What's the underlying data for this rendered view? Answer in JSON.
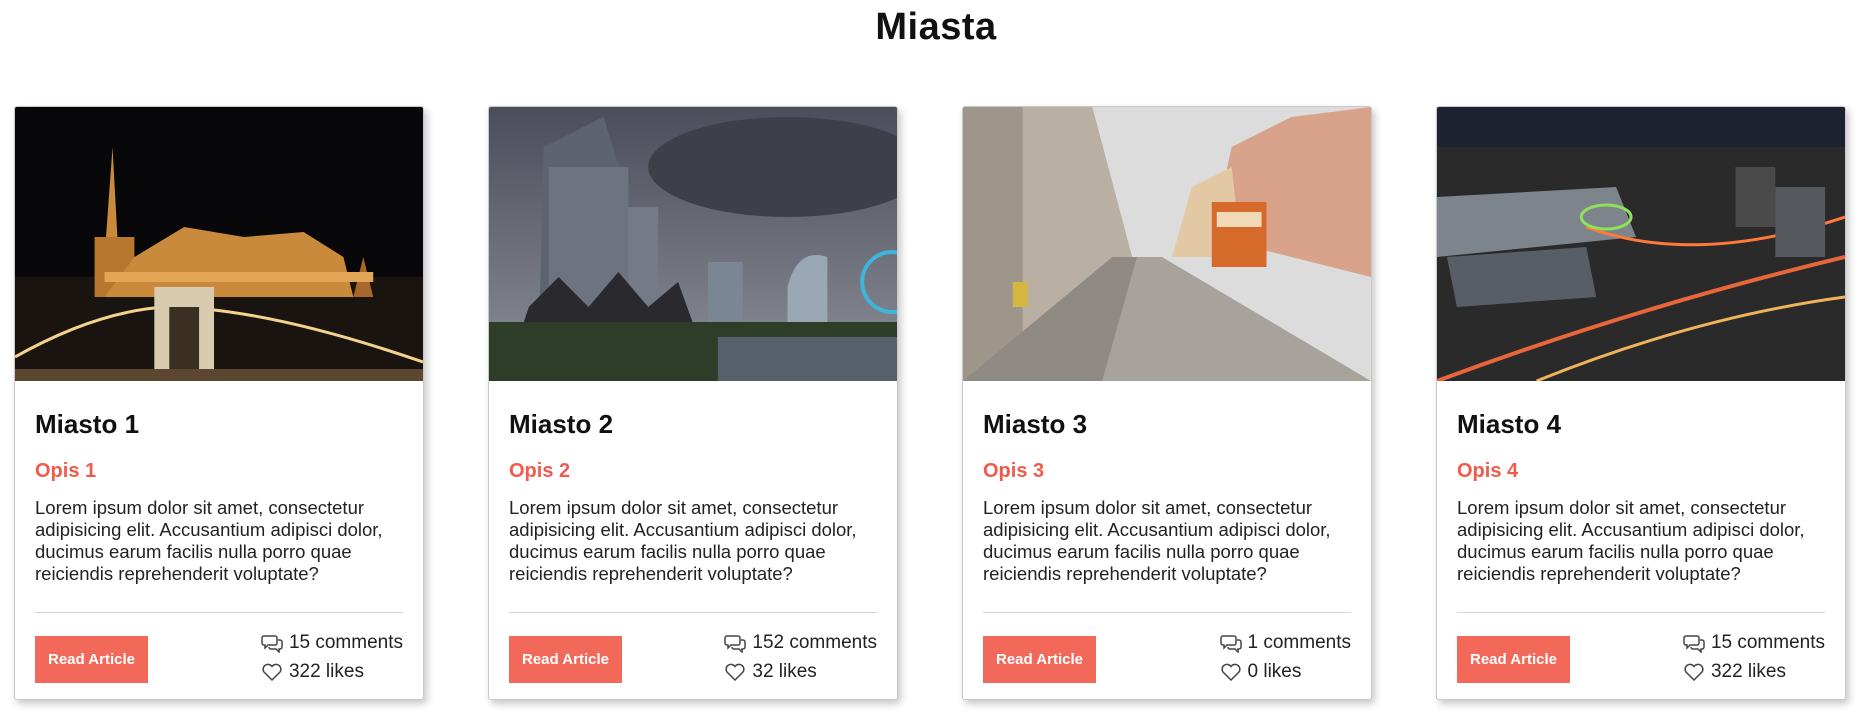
{
  "page": {
    "title": "Miasta"
  },
  "cards": [
    {
      "image_alt": "night cityscape with illuminated castle and chain bridge",
      "title": "Miasto 1",
      "subtitle": "Opis 1",
      "text": "Lorem ipsum dolor sit amet, consectetur adipisicing elit. Accusantium adipisci dolor, ducimus earum facilis nulla porro quae reiciendis reprehenderit voluptate?",
      "button_label": "Read Article",
      "comments": "15 comments",
      "likes": "322 likes"
    },
    {
      "image_alt": "skyscrapers under cloudy evening sky with ferris wheel",
      "title": "Miasto 2",
      "subtitle": "Opis 2",
      "text": "Lorem ipsum dolor sit amet, consectetur adipisicing elit. Accusantium adipisci dolor, ducimus earum facilis nulla porro quae reiciendis reprehenderit voluptate?",
      "button_label": "Read Article",
      "comments": "152 comments",
      "likes": "32 likes"
    },
    {
      "image_alt": "cobbled old town street with orange tram",
      "title": "Miasto 3",
      "subtitle": "Opis 3",
      "text": "Lorem ipsum dolor sit amet, consectetur adipisicing elit. Accusantium adipisci dolor, ducimus earum facilis nulla porro quae reiciendis reprehenderit voluptate?",
      "button_label": "Read Article",
      "comments": "1 comments",
      "likes": "0 likes"
    },
    {
      "image_alt": "aerial night view of city with light trails",
      "title": "Miasto 4",
      "subtitle": "Opis 4",
      "text": "Lorem ipsum dolor sit amet, consectetur adipisicing elit. Accusantium adipisci dolor, ducimus earum facilis nulla porro quae reiciendis reprehenderit voluptate?",
      "button_label": "Read Article",
      "comments": "15 comments",
      "likes": "322 likes"
    }
  ],
  "icons": {
    "comments": "comments-icon",
    "likes": "heart-icon"
  },
  "colors": {
    "accent": "#ef5b4c",
    "button": "#f2695a"
  }
}
